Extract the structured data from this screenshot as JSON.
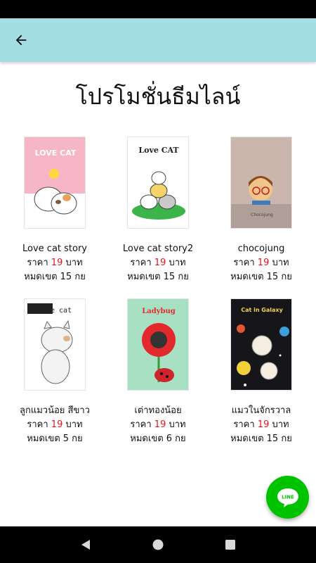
{
  "header": {
    "title": "โปรโมชั่นธีมไลน์"
  },
  "themes": [
    {
      "name": "Love cat story",
      "price_prefix": "ราคา",
      "price": "19",
      "price_unit": "บาท",
      "expiry": "หมดเขต 15 กย",
      "thumb_title": "LOVE CAT"
    },
    {
      "name": "Love cat story2",
      "price_prefix": "ราคา",
      "price": "19",
      "price_unit": "บาท",
      "expiry": "หมดเขต 15 กย",
      "thumb_title": "Love CAT"
    },
    {
      "name": "chocojung",
      "price_prefix": "ราคา",
      "price": "19",
      "price_unit": "บาท",
      "expiry": "หมดเขต 15 กย",
      "thumb_title": "Chocojung"
    },
    {
      "name": "ลูกแมวน้อย สีขาว",
      "price_prefix": "ราคา",
      "price": "19",
      "price_unit": "บาท",
      "expiry": "หมดเขต 5 กย",
      "thumb_title": "White cat"
    },
    {
      "name": "เต่าทองน้อย",
      "price_prefix": "ราคา",
      "price": "19",
      "price_unit": "บาท",
      "expiry": "หมดเขต 6 กย",
      "thumb_title": "Ladybug"
    },
    {
      "name": "แมวในจักรวาล",
      "price_prefix": "ราคา",
      "price": "19",
      "price_unit": "บาท",
      "expiry": "หมดเขต 15 กย",
      "thumb_title": "Cat in Galaxy"
    }
  ],
  "fab": {
    "label": "LINE",
    "color": "#00c300"
  },
  "colors": {
    "app_bar": "#a4dde4",
    "price": "#e8141c"
  },
  "icons": {
    "back": "arrow-left-icon",
    "nav_back": "triangle-back-icon",
    "nav_home": "circle-home-icon",
    "nav_recents": "square-recents-icon"
  }
}
